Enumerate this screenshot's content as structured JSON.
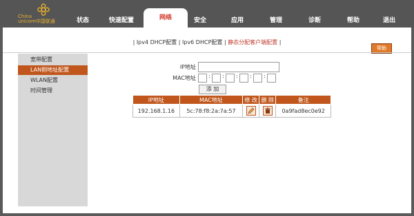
{
  "logo": {
    "line1": "China",
    "line2": "unicom",
    "line2_cn": "中国联通"
  },
  "nav": [
    {
      "label": "状态"
    },
    {
      "label": "快速配置"
    },
    {
      "label": "网络"
    },
    {
      "label": "安全"
    },
    {
      "label": "应用"
    },
    {
      "label": "管理"
    },
    {
      "label": "诊断"
    },
    {
      "label": "帮助"
    },
    {
      "label": "退出"
    }
  ],
  "subtabs": {
    "sep": "|",
    "items": [
      {
        "label": "Ipv4 DHCP配置"
      },
      {
        "label": "Ipv6 DHCP配置"
      },
      {
        "label": "静态分配客户端配置"
      }
    ]
  },
  "help_button": "帮助",
  "sidebar": {
    "items": [
      {
        "label": "宽带配置"
      },
      {
        "label": "LAN侧地址配置"
      },
      {
        "label": "WLAN配置"
      },
      {
        "label": "时间管理"
      }
    ]
  },
  "form": {
    "ip_label": "IP地址",
    "ip_value": "",
    "mac_label": "MAC地址",
    "mac_colon": ":",
    "add_button": "添 加"
  },
  "table": {
    "headers": [
      "IP地址",
      "MAC地址",
      "修 改",
      "删 除",
      "备注"
    ],
    "rows": [
      {
        "ip": "192.168.1.16",
        "mac": "5c:78:f8:2a:7a:57",
        "edit_icon": "edit-icon",
        "delete_icon": "trash-icon",
        "note": "0a9fad8ec0e92"
      }
    ]
  },
  "colors": {
    "accent": "#c0561c",
    "active_nav_text": "#d33a2c",
    "logo": "#e8b030",
    "help": "#e07a28"
  }
}
